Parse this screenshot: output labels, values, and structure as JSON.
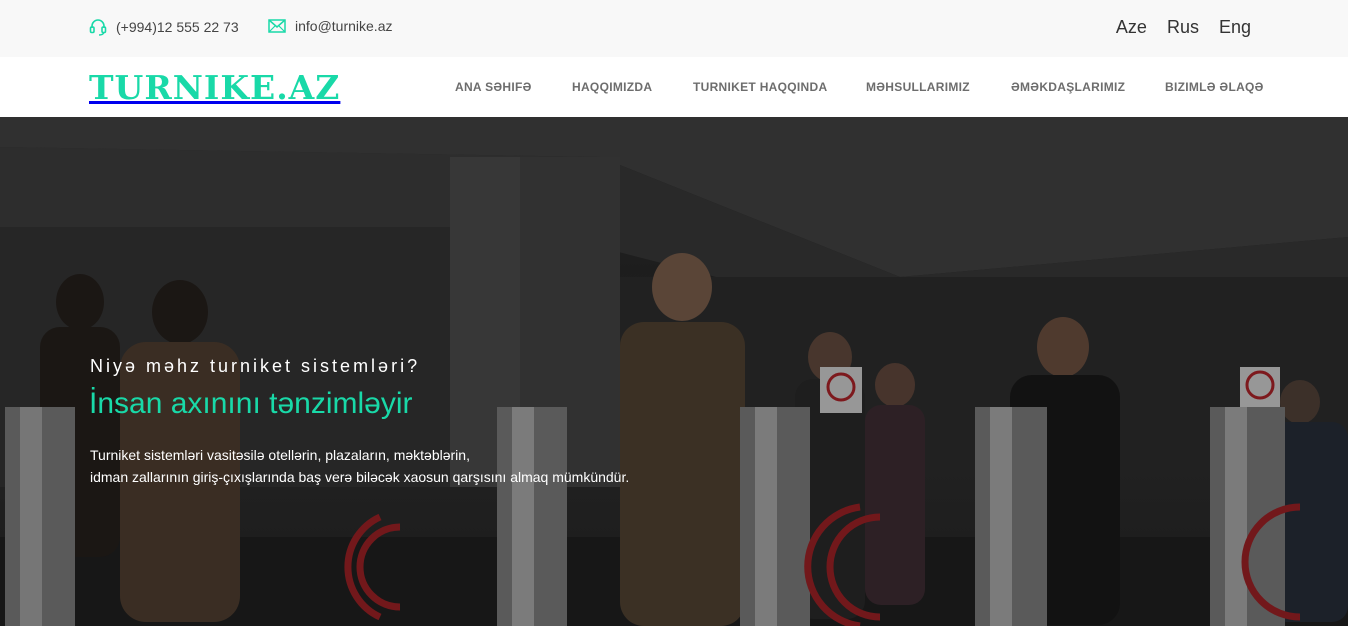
{
  "topbar": {
    "phone": "(+994)12 555 22 73",
    "email": "info@turnike.az",
    "languages": [
      "Aze",
      "Rus",
      "Eng"
    ]
  },
  "header": {
    "logo": "TURNIKE.AZ",
    "nav": [
      "ANA SƏHIFƏ",
      "HAQQIMIZDA",
      "TURNIKET HAQQINDA",
      "MƏHSULLARIMIZ",
      "ƏMƏKDAŞLARIMIZ",
      "BIZIMLƏ ƏLAQƏ"
    ]
  },
  "hero": {
    "subtitle": "Niyə məhz turniket sistemləri?",
    "title": "İnsan axınını tənzimləyir",
    "text_line1": "Turniket sistemləri vasitəsilə otellərin, plazaların, məktəblərin,",
    "text_line2": "idman zallarının giriş-çıxışlarında baş verə biləcək xaosun qarşısını almaq mümkündür."
  },
  "colors": {
    "accent": "#19d9a8",
    "topbar_bg": "#f8f8f8",
    "nav_text": "#6d6d6d"
  },
  "icons": {
    "phone": "headset-icon",
    "email": "envelope-icon"
  }
}
